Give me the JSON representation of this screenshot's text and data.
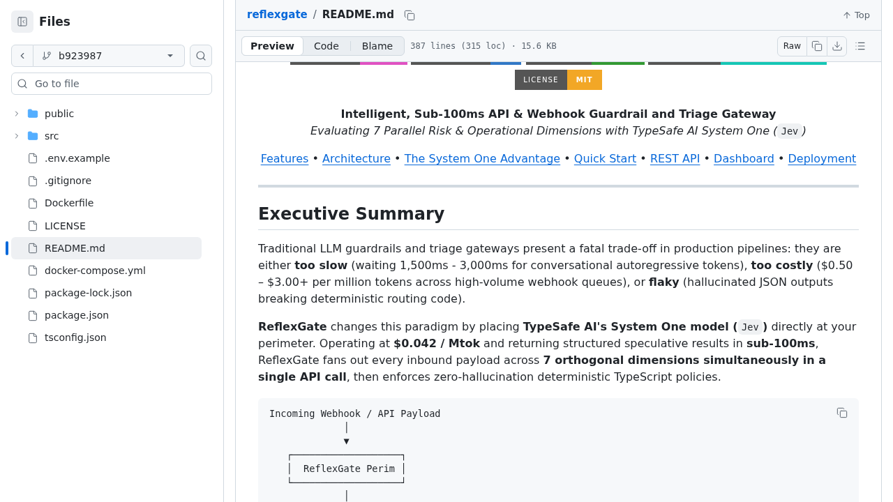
{
  "sidebar": {
    "title": "Files",
    "branch": "b923987",
    "file_search": {
      "placeholder": "Go to file"
    },
    "tree": [
      {
        "name": "public",
        "kind": "folder",
        "expanded": false,
        "selected": false
      },
      {
        "name": "src",
        "kind": "folder",
        "expanded": false,
        "selected": false
      },
      {
        "name": ".env.example",
        "kind": "file",
        "selected": false
      },
      {
        "name": ".gitignore",
        "kind": "file",
        "selected": false
      },
      {
        "name": "Dockerfile",
        "kind": "file",
        "selected": false
      },
      {
        "name": "LICENSE",
        "kind": "file",
        "selected": false
      },
      {
        "name": "README.md",
        "kind": "file",
        "selected": true
      },
      {
        "name": "docker-compose.yml",
        "kind": "file",
        "selected": false
      },
      {
        "name": "package-lock.json",
        "kind": "file",
        "selected": false
      },
      {
        "name": "package.json",
        "kind": "file",
        "selected": false
      },
      {
        "name": "tsconfig.json",
        "kind": "file",
        "selected": false
      }
    ]
  },
  "file_header": {
    "repo": "reflexgate",
    "separator": "/",
    "file": "README.md",
    "top_link": "Top"
  },
  "toolbar": {
    "tabs": [
      {
        "label": "Preview",
        "selected": true
      },
      {
        "label": "Code",
        "selected": false
      },
      {
        "label": "Blame",
        "selected": false
      }
    ],
    "file_info": "387 lines (315 loc) · 15.6 KB",
    "raw_button": "Raw"
  },
  "readme": {
    "partial_badges": [
      {
        "color": "#e052c2"
      },
      {
        "color": "#3178c6"
      },
      {
        "color": "#339933"
      },
      {
        "color": "#16c7b5"
      }
    ],
    "license_badge": {
      "label": "LICENSE",
      "value": "MIT"
    },
    "title": "Intelligent, Sub-100ms API & Webhook Guardrail and Triage Gateway",
    "subtitle": [
      {
        "kind": "text",
        "text": "Evaluating 7 Parallel Risk & Operational Dimensions with TypeSafe AI System One ("
      },
      {
        "kind": "code",
        "text": "Jev"
      },
      {
        "kind": "text",
        "text": ")"
      }
    ],
    "nav": [
      {
        "kind": "link",
        "text": "Features"
      },
      {
        "kind": "separator",
        "text": "•"
      },
      {
        "kind": "link",
        "text": "Architecture"
      },
      {
        "kind": "separator",
        "text": "•"
      },
      {
        "kind": "link",
        "text": "The System One Advantage"
      },
      {
        "kind": "separator",
        "text": "•"
      },
      {
        "kind": "link",
        "text": "Quick Start"
      },
      {
        "kind": "separator",
        "text": "•"
      },
      {
        "kind": "link",
        "text": "REST API"
      },
      {
        "kind": "separator",
        "text": "•"
      },
      {
        "kind": "link",
        "text": "Dashboard"
      },
      {
        "kind": "separator",
        "text": "•"
      },
      {
        "kind": "link",
        "text": "Deployment"
      }
    ],
    "heading": "Executive Summary",
    "paragraphs": [
      {
        "segments": [
          {
            "kind": "text",
            "text": "Traditional LLM guardrails and triage gateways present a fatal trade-off in production pipelines: they are either **too slow** (waiting 1,500ms - 3,000ms for conversational autoregressive tokens), **too costly** ($0.50 – $3.00+ per million tokens across high-volume webhook queues), or **flaky** (hallucinated JSON outputs breaking deterministic routing code)."
          }
        ]
      },
      {
        "segments": [
          {
            "kind": "text",
            "text": "**ReflexGate** changes this paradigm by placing **TypeSafe AI's System One model (**"
          },
          {
            "kind": "code",
            "text": "Jev"
          },
          {
            "kind": "text",
            "text": "**)** directly at your perimeter. Operating at **$0.042 / Mtok** and returning structured speculative results in **sub-100ms**, ReflexGate fans out every inbound payload across **7 orthogonal dimensions simultaneously in a single API call**, then enforces zero-hallucination deterministic TypeScript policies."
          }
        ]
      }
    ],
    "code_block": {
      "lines": [
        "Incoming Webhook / API Payload",
        "             │",
        "             ▼",
        "   ┌───────────────────┐",
        "   │  ReflexGate Perim │",
        "   └───────────────────┘",
        "             │"
      ]
    }
  }
}
